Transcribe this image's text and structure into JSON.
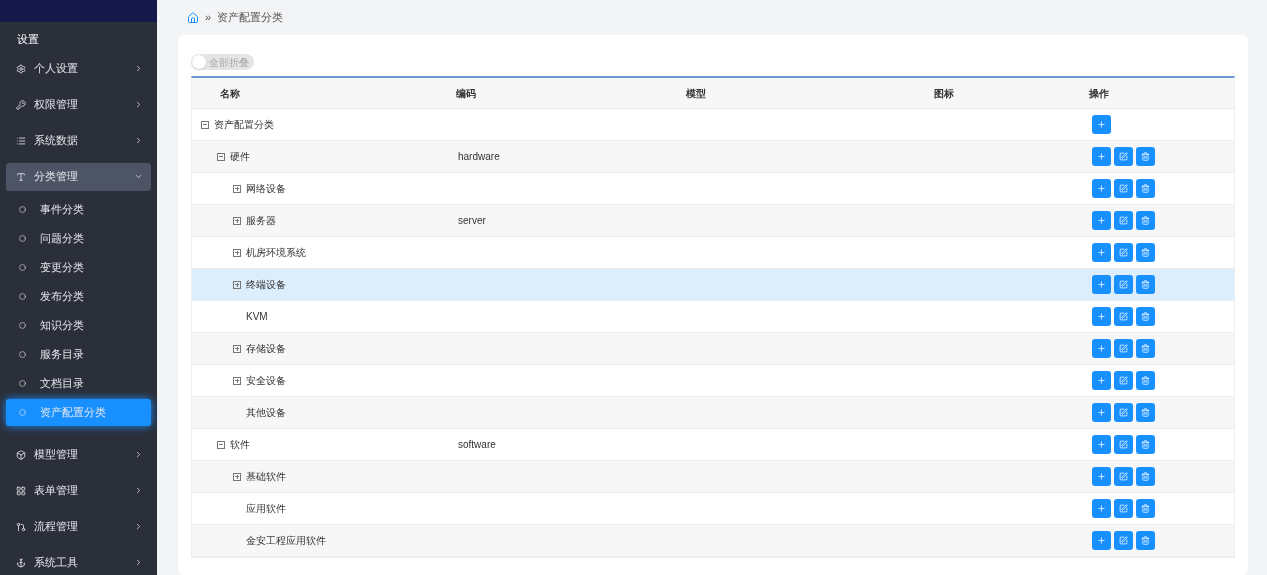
{
  "sidebar": {
    "section_title": "设置",
    "items": [
      {
        "label": "个人设置",
        "expanded": false,
        "selected": false
      },
      {
        "label": "权限管理",
        "expanded": false,
        "selected": false
      },
      {
        "label": "系统数据",
        "expanded": false,
        "selected": false
      },
      {
        "label": "分类管理",
        "expanded": true,
        "selected": true,
        "children": [
          {
            "label": "事件分类",
            "selected": false
          },
          {
            "label": "问题分类",
            "selected": false
          },
          {
            "label": "变更分类",
            "selected": false
          },
          {
            "label": "发布分类",
            "selected": false
          },
          {
            "label": "知识分类",
            "selected": false
          },
          {
            "label": "服务目录",
            "selected": false
          },
          {
            "label": "文档目录",
            "selected": false
          },
          {
            "label": "资产配置分类",
            "selected": true
          }
        ]
      },
      {
        "label": "模型管理",
        "expanded": false,
        "selected": false
      },
      {
        "label": "表单管理",
        "expanded": false,
        "selected": false
      },
      {
        "label": "流程管理",
        "expanded": false,
        "selected": false
      },
      {
        "label": "系统工具",
        "expanded": false,
        "selected": false
      }
    ]
  },
  "breadcrumb": {
    "separator": "»",
    "current": "资产配置分类"
  },
  "toggle": {
    "label": "全部折叠",
    "on": false
  },
  "table": {
    "columns": [
      "名称",
      "编码",
      "模型",
      "图标",
      "操作"
    ],
    "rows": [
      {
        "name": "资产配置分类",
        "expanded": true,
        "selected": false,
        "actions": [
          {
            "kind": "add"
          }
        ],
        "children": [
          {
            "name": "硬件",
            "code": "hardware",
            "expanded": true,
            "selected": false,
            "actions": [
              {
                "kind": "add"
              },
              {
                "kind": "edit"
              },
              {
                "kind": "delete"
              }
            ],
            "children": [
              {
                "name": "网络设备",
                "expanded": false,
                "selected": false,
                "actions": [
                  {
                    "kind": "add"
                  },
                  {
                    "kind": "edit"
                  },
                  {
                    "kind": "delete"
                  }
                ]
              },
              {
                "name": "服务器",
                "code": "server",
                "expanded": false,
                "selected": false,
                "actions": [
                  {
                    "kind": "add"
                  },
                  {
                    "kind": "edit"
                  },
                  {
                    "kind": "delete"
                  }
                ]
              },
              {
                "name": "机房环境系统",
                "expanded": false,
                "selected": false,
                "actions": [
                  {
                    "kind": "add"
                  },
                  {
                    "kind": "edit"
                  },
                  {
                    "kind": "delete"
                  }
                ]
              },
              {
                "name": "终端设备",
                "expanded": false,
                "selected": true,
                "actions": [
                  {
                    "kind": "add"
                  },
                  {
                    "kind": "edit"
                  },
                  {
                    "kind": "delete"
                  }
                ]
              },
              {
                "name": "KVM",
                "selected": false,
                "actions": [
                  {
                    "kind": "add"
                  },
                  {
                    "kind": "edit"
                  },
                  {
                    "kind": "delete"
                  }
                ]
              },
              {
                "name": "存储设备",
                "expanded": false,
                "selected": false,
                "actions": [
                  {
                    "kind": "add"
                  },
                  {
                    "kind": "edit"
                  },
                  {
                    "kind": "delete"
                  }
                ]
              },
              {
                "name": "安全设备",
                "expanded": false,
                "selected": false,
                "actions": [
                  {
                    "kind": "add"
                  },
                  {
                    "kind": "edit"
                  },
                  {
                    "kind": "delete"
                  }
                ]
              },
              {
                "name": "其他设备",
                "selected": false,
                "actions": [
                  {
                    "kind": "add"
                  },
                  {
                    "kind": "edit"
                  },
                  {
                    "kind": "delete"
                  }
                ]
              }
            ]
          },
          {
            "name": "软件",
            "code": "software",
            "expanded": true,
            "selected": false,
            "actions": [
              {
                "kind": "add"
              },
              {
                "kind": "edit"
              },
              {
                "kind": "delete"
              }
            ],
            "children": [
              {
                "name": "基础软件",
                "expanded": false,
                "selected": false,
                "actions": [
                  {
                    "kind": "add"
                  },
                  {
                    "kind": "edit"
                  },
                  {
                    "kind": "delete"
                  }
                ]
              },
              {
                "name": "应用软件",
                "selected": false,
                "actions": [
                  {
                    "kind": "add"
                  },
                  {
                    "kind": "edit"
                  },
                  {
                    "kind": "delete"
                  }
                ]
              },
              {
                "name": "金安工程应用软件",
                "selected": false,
                "actions": [
                  {
                    "kind": "add"
                  },
                  {
                    "kind": "edit"
                  },
                  {
                    "kind": "delete"
                  }
                ]
              }
            ]
          }
        ]
      }
    ]
  }
}
